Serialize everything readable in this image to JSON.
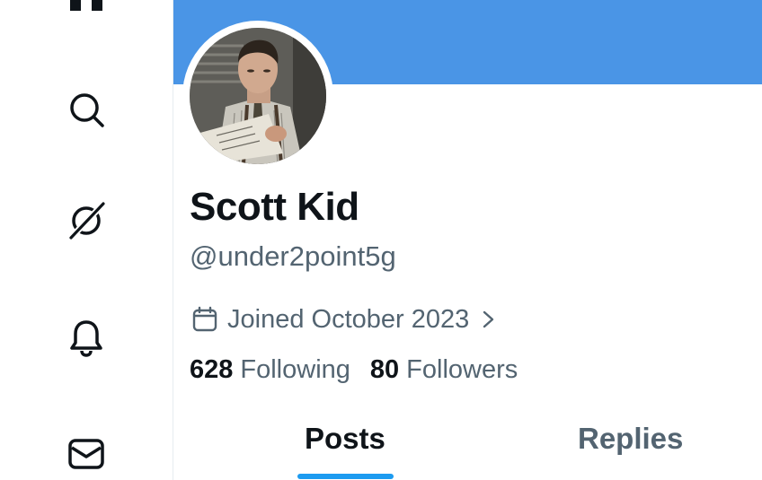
{
  "sidebar": {
    "items": [
      {
        "icon": "home-icon"
      },
      {
        "icon": "search-icon"
      },
      {
        "icon": "grok-icon"
      },
      {
        "icon": "bell-icon"
      },
      {
        "icon": "mail-icon"
      }
    ]
  },
  "profile": {
    "display_name": "Scott Kid",
    "handle": "@under2point5g",
    "joined": "Joined October 2023",
    "following_count": "628",
    "following_label": "Following",
    "followers_count": "80",
    "followers_label": "Followers",
    "banner_color": "#4a95e6"
  },
  "tabs": [
    {
      "label": "Posts",
      "active": true
    },
    {
      "label": "Replies",
      "active": false
    }
  ],
  "colors": {
    "accent": "#1d9bf0",
    "text_primary": "#0f1419",
    "text_secondary": "#536471"
  }
}
